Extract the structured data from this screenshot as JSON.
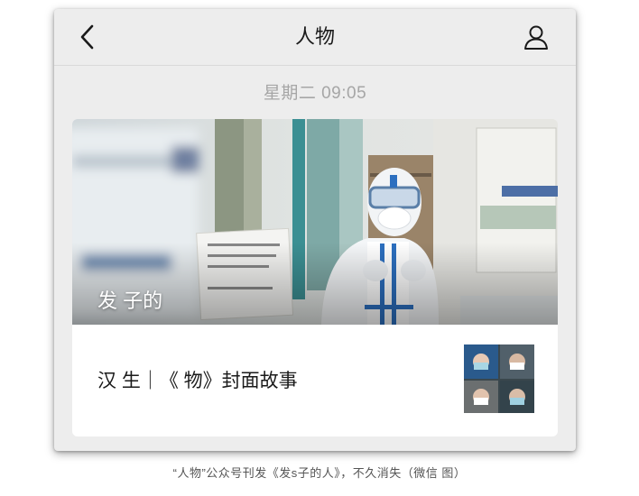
{
  "nav": {
    "title": "人物",
    "back_icon": "chevron-left-icon",
    "profile_icon": "person-icon"
  },
  "timestamp": "星期二 09:05",
  "article": {
    "cover_title": "发 子的",
    "sub_title": "汉 生｜《 物》封面故事"
  },
  "caption": "“人物”公众号刊发《发s子的人》，不久消失（微信 图）",
  "colors": {
    "background": "#ededed",
    "card": "#ffffff",
    "timestamp": "#a6a6a6",
    "text": "#1a1a1a"
  }
}
